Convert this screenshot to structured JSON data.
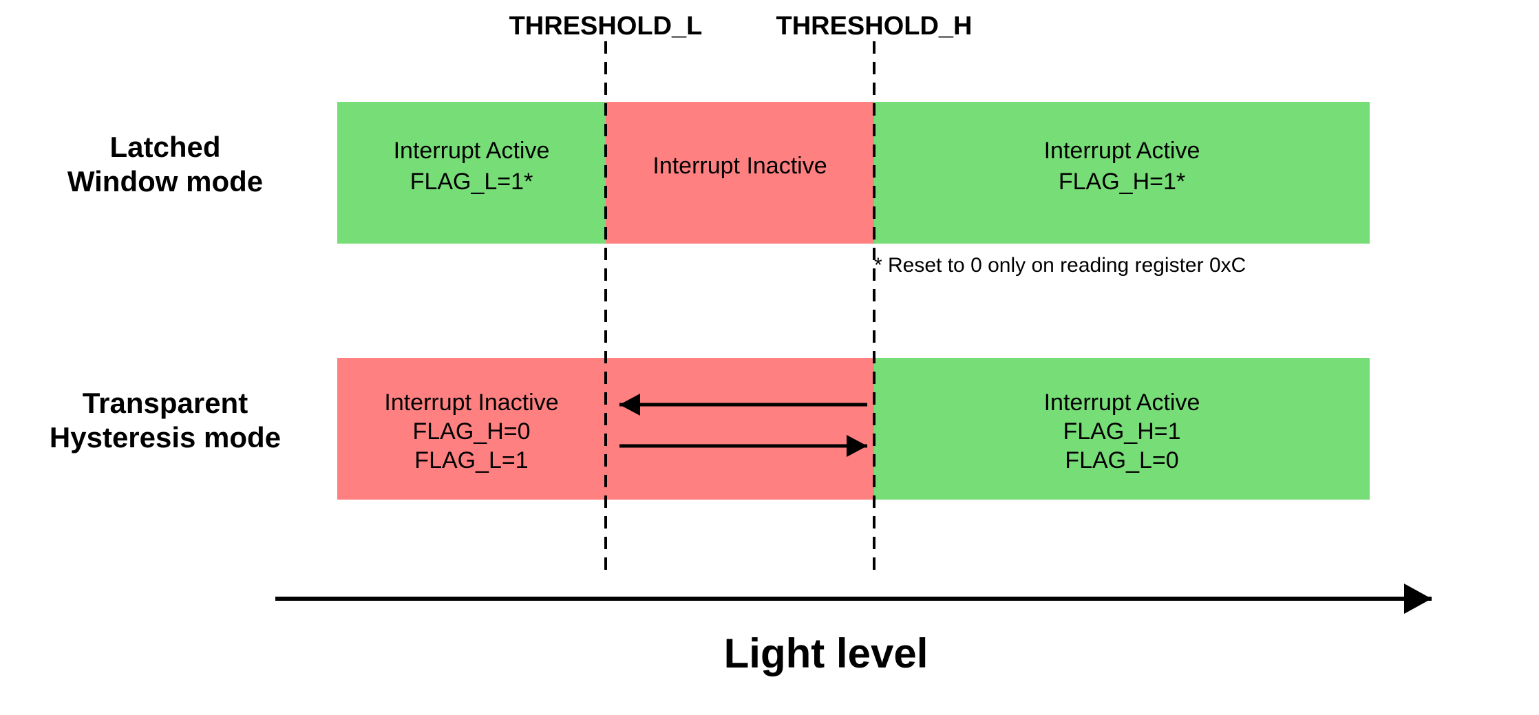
{
  "diagram": {
    "title": "Light level",
    "threshold_l_label": "THRESHOLD_L",
    "threshold_h_label": "THRESHOLD_H",
    "latched_mode_label": "Latched\nWindow mode",
    "transparent_mode_label": "Transparent\nHysteresis mode",
    "latched_left_line1": "Interrupt Active",
    "latched_left_line2": "FLAG_L=1*",
    "latched_middle_line1": "Interrupt Inactive",
    "latched_right_line1": "Interrupt Active",
    "latched_right_line2": "FLAG_H=1*",
    "reset_note": "* Reset to 0 only on reading register 0xC",
    "transparent_left_line1": "Interrupt Inactive",
    "transparent_left_line2": "FLAG_H=0",
    "transparent_left_line3": "FLAG_L=1",
    "transparent_right_line1": "Interrupt Active",
    "transparent_right_line2": "FLAG_H=1",
    "transparent_right_line3": "FLAG_L=0",
    "colors": {
      "green": "#77dd77",
      "red": "#ff8080",
      "black": "#000000",
      "white": "#ffffff"
    }
  }
}
